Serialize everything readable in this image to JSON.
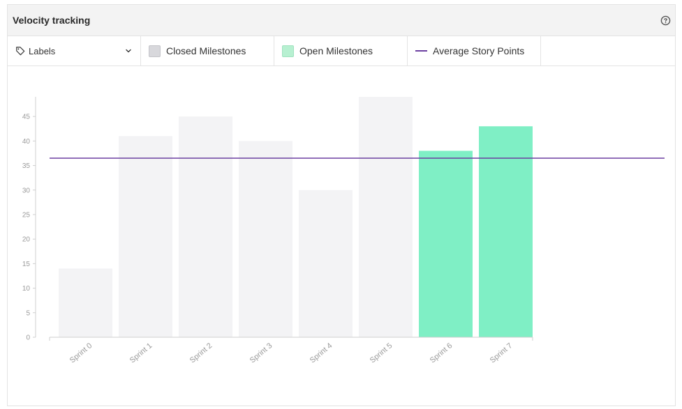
{
  "panel": {
    "title": "Velocity tracking",
    "help_icon": "question-circle-icon"
  },
  "legend": {
    "labels_dropdown": {
      "label": "Labels",
      "icon": "tag-icon",
      "chevron": "chevron-down-icon"
    },
    "closed_label": "Closed Milestones",
    "open_label": "Open Milestones",
    "average_label": "Average Story Points"
  },
  "colors": {
    "closed": "#f3f3f5",
    "open": "#7fefc5",
    "average": "#6b3fa0",
    "axis": "#cfcfcf",
    "tick_text": "#9a9a9a"
  },
  "chart_data": {
    "type": "bar",
    "categories": [
      "Sprint 0",
      "Sprint 1",
      "Sprint 2",
      "Sprint 3",
      "Sprint 4",
      "Sprint 5",
      "Sprint 6",
      "Sprint 7"
    ],
    "series": [
      {
        "name": "Closed Milestones",
        "values": [
          14,
          41,
          45,
          40,
          30,
          49,
          null,
          null
        ]
      },
      {
        "name": "Open Milestones",
        "values": [
          null,
          null,
          null,
          null,
          null,
          null,
          38,
          43
        ]
      }
    ],
    "average": {
      "name": "Average Story Points",
      "value": 36.5
    },
    "yticks": [
      0,
      5,
      10,
      15,
      20,
      25,
      30,
      35,
      40,
      45
    ],
    "ylim": [
      0,
      49
    ],
    "xlabel": "",
    "ylabel": "",
    "grid": false
  }
}
